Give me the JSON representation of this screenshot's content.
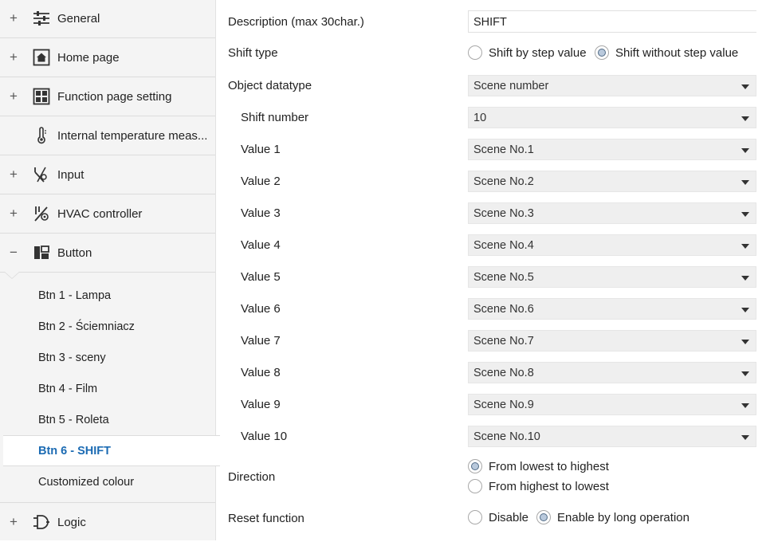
{
  "sidebar": {
    "items": [
      {
        "toggle": "+",
        "icon": "sliders-icon",
        "label": "General"
      },
      {
        "toggle": "+",
        "icon": "home-icon",
        "label": "Home page"
      },
      {
        "toggle": "+",
        "icon": "grid-icon",
        "label": "Function page setting"
      },
      {
        "toggle": "",
        "icon": "thermometer-icon",
        "label": "Internal temperature meas..."
      },
      {
        "toggle": "+",
        "icon": "input-switch-icon",
        "label": "Input"
      },
      {
        "toggle": "+",
        "icon": "hvac-icon",
        "label": "HVAC controller"
      },
      {
        "toggle": "−",
        "icon": "button-layout-icon",
        "label": "Button"
      },
      {
        "toggle": "+",
        "icon": "logic-icon",
        "label": "Logic"
      }
    ],
    "sub_items": [
      {
        "label": "Btn 1 - Lampa"
      },
      {
        "label": "Btn 2 - Ściemniacz"
      },
      {
        "label": "Btn 3 - sceny"
      },
      {
        "label": "Btn 4 - Film"
      },
      {
        "label": "Btn 5 - Roleta"
      },
      {
        "label": "Btn 6 - SHIFT"
      },
      {
        "label": "Customized colour"
      }
    ]
  },
  "form": {
    "description_label": "Description (max 30char.)",
    "description_value": "SHIFT",
    "shift_type_label": "Shift type",
    "shift_type_options": [
      "Shift by step value",
      "Shift without step value"
    ],
    "object_datatype_label": "Object datatype",
    "object_datatype_value": "Scene number",
    "shift_number_label": "Shift number",
    "shift_number_value": "10",
    "values": [
      {
        "label": "Value 1",
        "value": "Scene No.1"
      },
      {
        "label": "Value 2",
        "value": "Scene No.2"
      },
      {
        "label": "Value 3",
        "value": "Scene No.3"
      },
      {
        "label": "Value 4",
        "value": "Scene No.4"
      },
      {
        "label": "Value 5",
        "value": "Scene No.5"
      },
      {
        "label": "Value 6",
        "value": "Scene No.6"
      },
      {
        "label": "Value 7",
        "value": "Scene No.7"
      },
      {
        "label": "Value 8",
        "value": "Scene No.8"
      },
      {
        "label": "Value 9",
        "value": "Scene No.9"
      },
      {
        "label": "Value 10",
        "value": "Scene No.10"
      }
    ],
    "direction_label": "Direction",
    "direction_options": [
      "From lowest to highest",
      "From highest to lowest"
    ],
    "reset_label": "Reset function",
    "reset_options": [
      "Disable",
      "Enable by long operation"
    ]
  },
  "colors": {
    "active": "#1c6bb3",
    "sidebar_bg": "#f4f4f4",
    "dropdown_bg": "#efefef"
  }
}
